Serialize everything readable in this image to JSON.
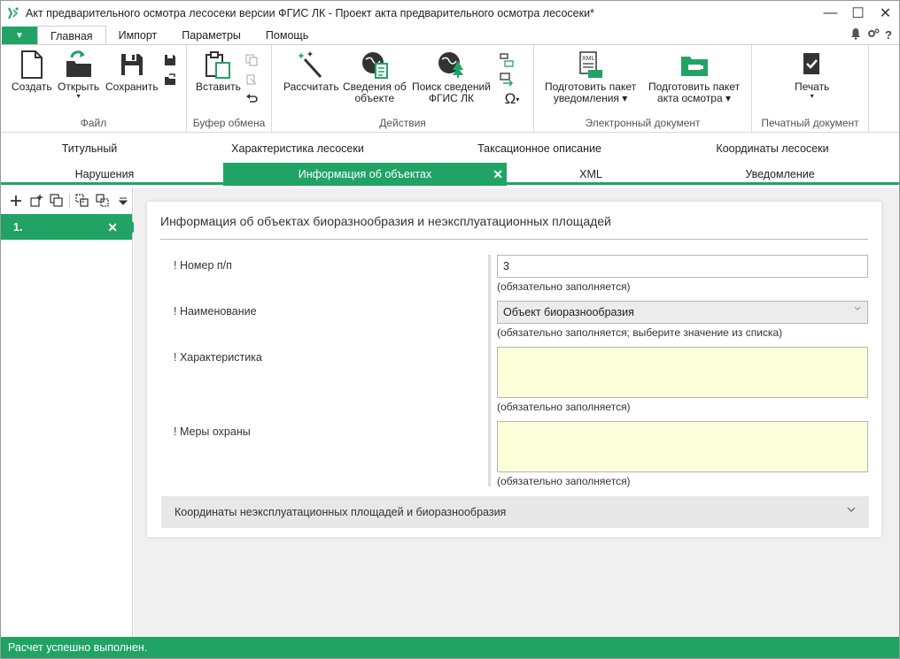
{
  "window": {
    "title": "Акт предварительного осмотра лесосеки версии ФГИС ЛК - Проект акта предварительного осмотра лесосеки*",
    "minimize": "—",
    "maximize": "☐",
    "close": "✕"
  },
  "ribbon_tabs": {
    "file_glyph": "▼",
    "items": [
      "Главная",
      "Импорт",
      "Параметры",
      "Помощь"
    ],
    "help": "?"
  },
  "ribbon": {
    "groups": {
      "file": "Файл",
      "clipboard": "Буфер обмена",
      "actions": "Действия",
      "edoc": "Электронный документ",
      "print": "Печатный документ"
    },
    "buttons": {
      "create": "Создать",
      "open": "Открыть",
      "save": "Сохранить",
      "paste": "Вставить",
      "calculate": "Рассчитать",
      "object_info_1": "Сведения об",
      "object_info_2": "объекте",
      "search_1": "Поиск сведений",
      "search_2": "ФГИС ЛК",
      "notif_pkg_1": "Подготовить пакет",
      "notif_pkg_2": "уведомления",
      "act_pkg_1": "Подготовить пакет",
      "act_pkg_2": "акта осмотра",
      "print": "Печать",
      "omega": "Ω"
    },
    "dropdown_glyph": "▾"
  },
  "doc_tabs": {
    "row1": [
      "Титульный",
      "Характеристика лесосеки",
      "Таксационное описание",
      "Координаты лесосеки"
    ],
    "row2": [
      "Нарушения",
      "Информация об объектах",
      "XML",
      "Уведомление"
    ],
    "close_glyph": "✕"
  },
  "left_pane": {
    "items": [
      "1."
    ],
    "close_glyph": "✕"
  },
  "form": {
    "title": "Информация об объектах биоразнообразия и неэксплуатационных площадей",
    "fields": {
      "number": {
        "label": "! Номер п/п",
        "value": "3",
        "hint": "(обязательно заполняется)"
      },
      "name": {
        "label": "! Наименование",
        "value": "Объект биоразнообразия",
        "hint": "(обязательно заполняется; выберите значение из списка)"
      },
      "characteristic": {
        "label": "! Характеристика",
        "value": "",
        "hint": "(обязательно заполняется)"
      },
      "protection": {
        "label": "! Меры охраны",
        "value": "",
        "hint": "(обязательно заполняется)"
      }
    },
    "accordion": "Координаты неэксплуатационных площадей и биоразнообразия"
  },
  "status": "Расчет успешно выполнен.",
  "colors": {
    "accent": "#21a366",
    "required_bg": "#fbfed8"
  }
}
